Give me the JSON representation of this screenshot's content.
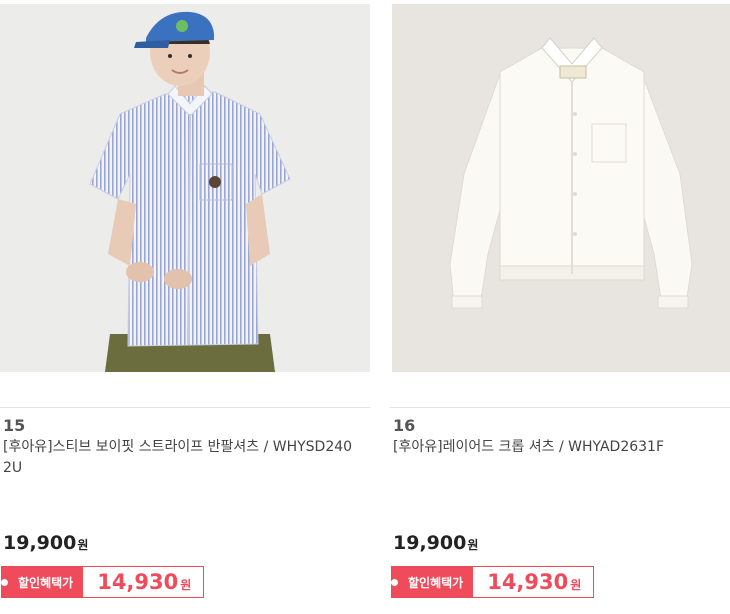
{
  "products": [
    {
      "rank": "15",
      "name": "[후아유]스티브 보이핏 스트라이프 반팔셔츠 / WHYSD2402U",
      "price": "19,900",
      "price_unit": "원",
      "sale_label": "할인혜택가",
      "sale_price": "14,930",
      "sale_unit": "원",
      "image_icon": "striped-shirt-model-photo"
    },
    {
      "rank": "16",
      "name": "[후아유]레이어드 크롭 셔츠 / WHYAD2631F",
      "price": "19,900",
      "price_unit": "원",
      "sale_label": "할인혜택가",
      "sale_price": "14,930",
      "sale_unit": "원",
      "image_icon": "white-crop-shirt-photo"
    }
  ],
  "colors": {
    "sale_accent": "#ef4b5a",
    "divider": "#e3e3e3",
    "photo_bg_1": "#ececea",
    "photo_bg_2": "#e8e5e1"
  }
}
